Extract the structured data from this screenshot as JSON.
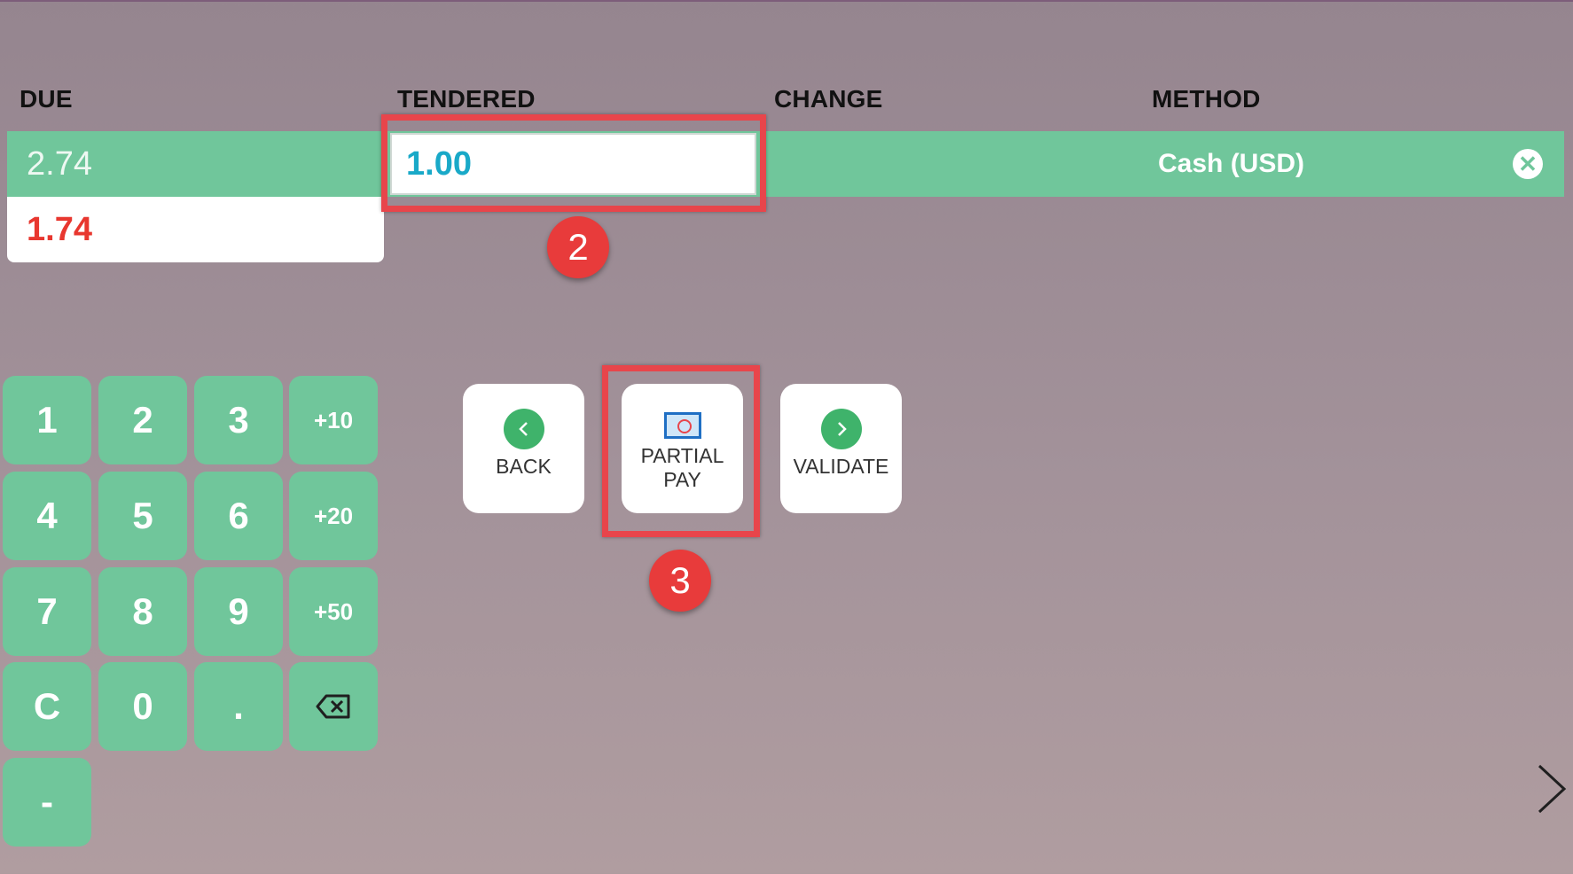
{
  "columns": {
    "due": "DUE",
    "tendered": "TENDERED",
    "change": "CHANGE",
    "method": "METHOD"
  },
  "payment_line": {
    "due": "2.74",
    "tendered": "1.00",
    "change": "",
    "method": "Cash (USD)",
    "delete_icon": "close-circle-icon"
  },
  "remaining_due": "1.74",
  "colors": {
    "accent_green": "#70c69b",
    "tendered_text": "#19a9c8",
    "remaining_red": "#e8372f",
    "highlight_red": "#e8454b"
  },
  "numpad": {
    "keys": [
      "1",
      "2",
      "3",
      "+10",
      "4",
      "5",
      "6",
      "+20",
      "7",
      "8",
      "9",
      "+50",
      "C",
      "0",
      ".",
      "⌫",
      "-"
    ]
  },
  "actions": {
    "back": "BACK",
    "partial_pay_line1": "PARTIAL",
    "partial_pay_line2": "PAY",
    "validate": "VALIDATE"
  },
  "annotations": {
    "step2": "2",
    "step3": "3"
  }
}
